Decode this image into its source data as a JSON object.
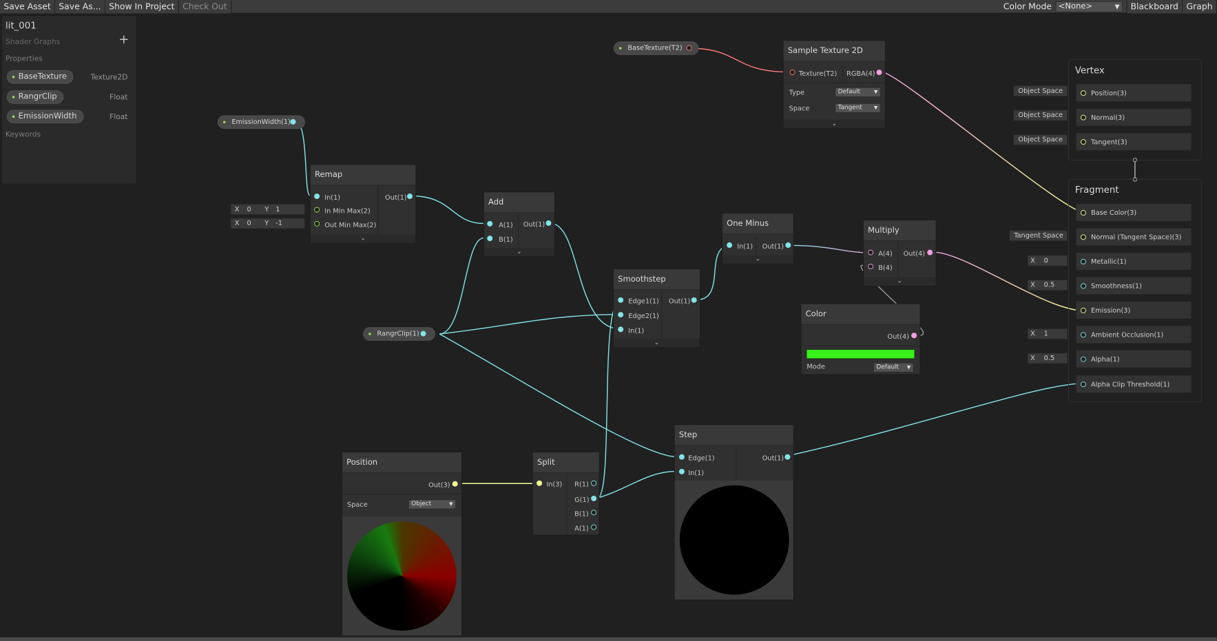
{
  "toolbar": {
    "save_asset": "Save Asset",
    "save_as": "Save As...",
    "show_in_project": "Show In Project",
    "check_out": "Check Out",
    "color_mode_label": "Color Mode",
    "color_mode_value": "<None>",
    "blackboard": "Blackboard",
    "graph": "Graph"
  },
  "blackboard": {
    "title": "lit_001",
    "subtitle": "Shader Graphs",
    "add": "+",
    "properties_label": "Properties",
    "keywords_label": "Keywords",
    "properties": [
      {
        "name": "BaseTexture",
        "type": "Texture2D"
      },
      {
        "name": "RangrClip",
        "type": "Float"
      },
      {
        "name": "EmissionWidth",
        "type": "Float"
      }
    ]
  },
  "nodes": {
    "base_texture_prop": "BaseTexture(T2)",
    "emission_width_prop": "EmissionWidth(1)",
    "rangr_clip_prop": "RangrClip(1)",
    "remap": {
      "title": "Remap",
      "in": "In(1)",
      "in_min_max": "In Min Max(2)",
      "out_min_max": "Out Min Max(2)",
      "out": "Out(1)",
      "in_x": "0",
      "in_y": "1",
      "out_x": "0",
      "out_y": "-1",
      "x": "X",
      "y": "Y"
    },
    "add": {
      "title": "Add",
      "a": "A(1)",
      "b": "B(1)",
      "out": "Out(1)"
    },
    "sample": {
      "title": "Sample Texture 2D",
      "texture": "Texture(T2)",
      "rgba": "RGBA(4)",
      "type_label": "Type",
      "type_value": "Default",
      "space_label": "Space",
      "space_value": "Tangent"
    },
    "one_minus": {
      "title": "One Minus",
      "in": "In(1)",
      "out": "Out(1)"
    },
    "smoothstep": {
      "title": "Smoothstep",
      "edge1": "Edge1(1)",
      "edge2": "Edge2(1)",
      "in": "In(1)",
      "out": "Out(1)"
    },
    "multiply": {
      "title": "Multiply",
      "a": "A(4)",
      "b": "B(4)",
      "out": "Out(4)"
    },
    "color": {
      "title": "Color",
      "out": "Out(4)",
      "swatch": "#39f01c",
      "mode_label": "Mode",
      "mode_value": "Default"
    },
    "position": {
      "title": "Position",
      "out": "Out(3)",
      "space_label": "Space",
      "space_value": "Object"
    },
    "split": {
      "title": "Split",
      "in": "In(3)",
      "r": "R(1)",
      "g": "G(1)",
      "b": "B(1)",
      "a": "A(1)"
    },
    "step": {
      "title": "Step",
      "edge": "Edge(1)",
      "in": "In(1)",
      "out": "Out(1)"
    }
  },
  "vertex": {
    "title": "Vertex",
    "slots": [
      {
        "label": "Position(3)",
        "input": "Object Space"
      },
      {
        "label": "Normal(3)",
        "input": "Object Space"
      },
      {
        "label": "Tangent(3)",
        "input": "Object Space"
      }
    ]
  },
  "fragment": {
    "title": "Fragment",
    "slots": [
      {
        "label": "Base Color(3)"
      },
      {
        "label": "Normal (Tangent Space)(3)",
        "input": "Tangent Space"
      },
      {
        "label": "Metallic(1)",
        "x": "0"
      },
      {
        "label": "Smoothness(1)",
        "x": "0.5"
      },
      {
        "label": "Emission(3)"
      },
      {
        "label": "Ambient Occlusion(1)",
        "x": "1"
      },
      {
        "label": "Alpha(1)",
        "x": "0.5"
      },
      {
        "label": "Alpha Clip Threshold(1)"
      }
    ],
    "x_label": "X"
  }
}
